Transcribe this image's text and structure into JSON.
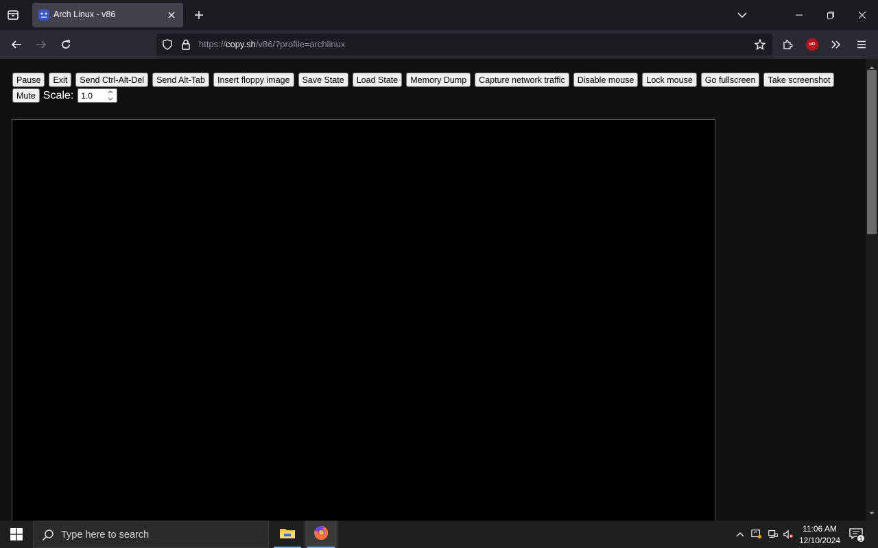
{
  "browser": {
    "tab": {
      "title": "Arch Linux - v86"
    },
    "url": {
      "scheme": "https://",
      "host": "copy.sh",
      "path": "/v86/?profile=archlinux"
    }
  },
  "page": {
    "controls_row1": [
      "Pause",
      "Exit",
      "Send Ctrl-Alt-Del",
      "Send Alt-Tab",
      "Insert floppy image",
      "Save State",
      "Load State",
      "Memory Dump",
      "Capture network traffic",
      "Disable mouse",
      "Lock mouse",
      "Go fullscreen",
      "Take screenshot"
    ],
    "mute_label": "Mute",
    "scale_label": "Scale:",
    "scale_value": "1.0",
    "screen_color": "#000000"
  },
  "taskbar": {
    "search_placeholder": "Type here to search",
    "time": "11:06 AM",
    "date": "12/10/2024",
    "notification_count": "1"
  },
  "colors": {
    "tab_active": "#42414d",
    "toolbar": "#2b2a33",
    "page_bg": "#101010",
    "taskbar": "#1f1f1f"
  }
}
